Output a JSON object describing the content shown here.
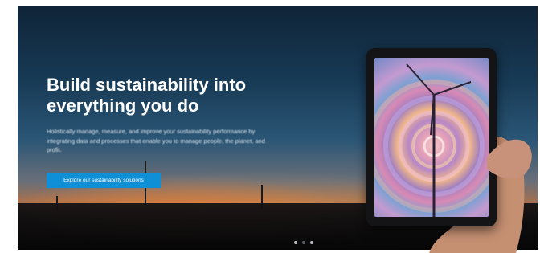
{
  "hero": {
    "title": "Build sustainability into everything you do",
    "description": "Holistically manage, measure, and improve your sustainability performance by integrating data and processes that enable you to manage people, the planet, and profit.",
    "cta_label": "Explore our sustainability solutions"
  },
  "carousel": {
    "slide_count": 3,
    "active_index": 1
  },
  "colors": {
    "cta": "#0f8fd6",
    "sky_top": "#0f2438",
    "sunset": "#f07828"
  },
  "icons": [
    "wind-turbine-icon"
  ]
}
